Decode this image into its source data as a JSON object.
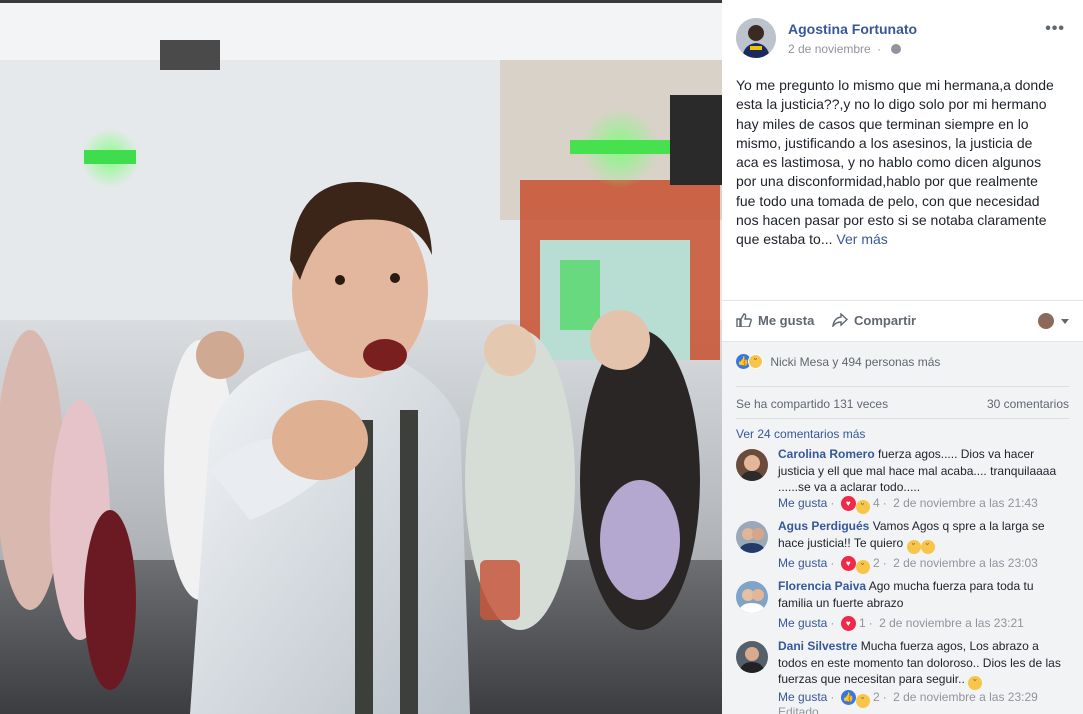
{
  "post": {
    "author": "Agostina Fortunato",
    "date": "2 de noviembre",
    "privacy_icon": "globe-icon",
    "more_label": "•••",
    "text": "Yo me pregunto lo mismo que mi hermana,a donde esta la justicia??,y no lo digo solo por mi hermano hay miles de casos que terminan siempre en lo mismo, justificando a los asesinos, la justicia de aca es lastimosa, y no hablo como dicen algunos por una disconformidad,hablo por que realmente fue todo una tomada de pelo, con que necesidad nos hacen pasar por esto si se notaba claramente que estaba to...",
    "see_more": "Ver más"
  },
  "actions": {
    "like": "Me gusta",
    "share": "Compartir"
  },
  "reactions": {
    "icons": [
      "like-icon",
      "sad-icon"
    ],
    "text": "Nicki Mesa y 494 personas más"
  },
  "stats": {
    "shares": "Se ha compartido 131 veces",
    "comments": "30 comentarios"
  },
  "view_more_comments": "Ver 24 comentarios más",
  "comments": [
    {
      "name": "Carolina Romero",
      "text": "fuerza agos..... Dios va hacer justicia y ell que mal hace mal acaba.... tranquilaaaa ......se va a aclarar todo.....",
      "like": "Me gusta",
      "count": "4",
      "time": "2 de noviembre a las 21:43"
    },
    {
      "name": "Agus Perdigués",
      "text": "Vamos Agos q spre a la larga se hace justicia!! Te quiero",
      "like": "Me gusta",
      "count": "2",
      "time": "2 de noviembre a las 23:03"
    },
    {
      "name": "Florencia Paiva",
      "text": "Ago mucha fuerza para toda tu familia un fuerte abrazo",
      "like": "Me gusta",
      "count": "1",
      "time": "2 de noviembre a las 23:21"
    },
    {
      "name": "Dani Silvestre",
      "text": "Mucha fuerza agos, Los abrazo a todos en este momento tan doloroso.. Dios les de las fuerzas que necesitan para seguir..",
      "like": "Me gusta",
      "count": "2",
      "time": "2 de noviembre a las 23:29",
      "edited": "Editado"
    }
  ],
  "colors": {
    "link": "#365899",
    "muted": "#90949c",
    "like_blue": "#3578e5",
    "sad_yellow": "#f7c54a",
    "love_red": "#f0284a"
  }
}
